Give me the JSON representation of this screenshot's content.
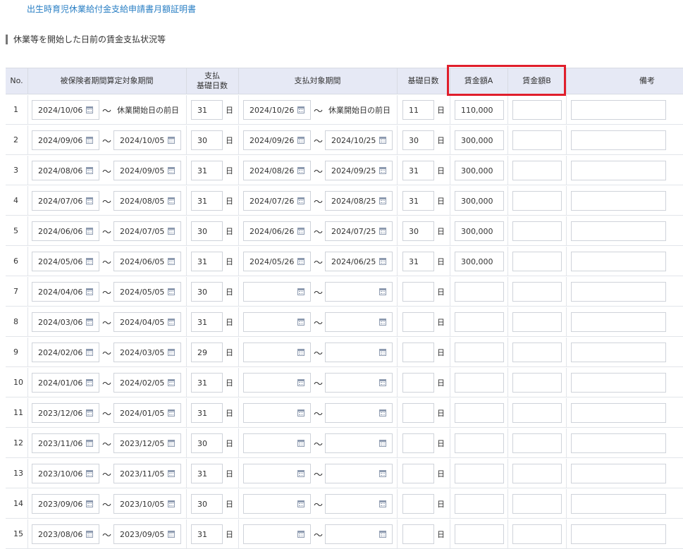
{
  "header": {
    "link_text": "出生時育児休業給付金支給申請書月額証明書"
  },
  "section": {
    "title": "休業等を開始した日前の賃金支払状況等"
  },
  "columns": {
    "no": "No.",
    "period": "被保険者期間算定対象期間",
    "base_days_l1": "支払",
    "base_days_l2": "基礎日数",
    "pay_period": "支払対象期間",
    "days": "基礎日数",
    "wage_a": "賃金額A",
    "wage_b": "賃金額B",
    "notes": "備考"
  },
  "labels": {
    "tilde": "〜",
    "day_unit": "日"
  },
  "icons": {
    "calendar": "calendar-icon"
  },
  "colors": {
    "accent_link": "#2a7fc4",
    "header_bg": "#e6e9f5",
    "highlight": "#e01e2b"
  },
  "rows": [
    {
      "no": "1",
      "p_from": "2024/10/06",
      "p_to": "休業開始日の前日",
      "p_to_plain": true,
      "base": "31",
      "pay_from": "2024/10/26",
      "pay_to": "休業開始日の前日",
      "pay_to_plain": true,
      "days": "11",
      "wage_a": "110,000",
      "wage_b": "",
      "notes": ""
    },
    {
      "no": "2",
      "p_from": "2024/09/06",
      "p_to": "2024/10/05",
      "base": "30",
      "pay_from": "2024/09/26",
      "pay_to": "2024/10/25",
      "days": "30",
      "wage_a": "300,000",
      "wage_b": "",
      "notes": ""
    },
    {
      "no": "3",
      "p_from": "2024/08/06",
      "p_to": "2024/09/05",
      "base": "31",
      "pay_from": "2024/08/26",
      "pay_to": "2024/09/25",
      "days": "31",
      "wage_a": "300,000",
      "wage_b": "",
      "notes": ""
    },
    {
      "no": "4",
      "p_from": "2024/07/06",
      "p_to": "2024/08/05",
      "base": "31",
      "pay_from": "2024/07/26",
      "pay_to": "2024/08/25",
      "days": "31",
      "wage_a": "300,000",
      "wage_b": "",
      "notes": ""
    },
    {
      "no": "5",
      "p_from": "2024/06/06",
      "p_to": "2024/07/05",
      "base": "30",
      "pay_from": "2024/06/26",
      "pay_to": "2024/07/25",
      "days": "30",
      "wage_a": "300,000",
      "wage_b": "",
      "notes": ""
    },
    {
      "no": "6",
      "p_from": "2024/05/06",
      "p_to": "2024/06/05",
      "base": "31",
      "pay_from": "2024/05/26",
      "pay_to": "2024/06/25",
      "days": "31",
      "wage_a": "300,000",
      "wage_b": "",
      "notes": ""
    },
    {
      "no": "7",
      "p_from": "2024/04/06",
      "p_to": "2024/05/05",
      "base": "30",
      "pay_from": "",
      "pay_to": "",
      "days": "",
      "wage_a": "",
      "wage_b": "",
      "notes": ""
    },
    {
      "no": "8",
      "p_from": "2024/03/06",
      "p_to": "2024/04/05",
      "base": "31",
      "pay_from": "",
      "pay_to": "",
      "days": "",
      "wage_a": "",
      "wage_b": "",
      "notes": ""
    },
    {
      "no": "9",
      "p_from": "2024/02/06",
      "p_to": "2024/03/05",
      "base": "29",
      "pay_from": "",
      "pay_to": "",
      "days": "",
      "wage_a": "",
      "wage_b": "",
      "notes": ""
    },
    {
      "no": "10",
      "p_from": "2024/01/06",
      "p_to": "2024/02/05",
      "base": "31",
      "pay_from": "",
      "pay_to": "",
      "days": "",
      "wage_a": "",
      "wage_b": "",
      "notes": ""
    },
    {
      "no": "11",
      "p_from": "2023/12/06",
      "p_to": "2024/01/05",
      "base": "31",
      "pay_from": "",
      "pay_to": "",
      "days": "",
      "wage_a": "",
      "wage_b": "",
      "notes": ""
    },
    {
      "no": "12",
      "p_from": "2023/11/06",
      "p_to": "2023/12/05",
      "base": "30",
      "pay_from": "",
      "pay_to": "",
      "days": "",
      "wage_a": "",
      "wage_b": "",
      "notes": ""
    },
    {
      "no": "13",
      "p_from": "2023/10/06",
      "p_to": "2023/11/05",
      "base": "31",
      "pay_from": "",
      "pay_to": "",
      "days": "",
      "wage_a": "",
      "wage_b": "",
      "notes": ""
    },
    {
      "no": "14",
      "p_from": "2023/09/06",
      "p_to": "2023/10/05",
      "base": "30",
      "pay_from": "",
      "pay_to": "",
      "days": "",
      "wage_a": "",
      "wage_b": "",
      "notes": ""
    },
    {
      "no": "15",
      "p_from": "2023/08/06",
      "p_to": "2023/09/05",
      "base": "31",
      "pay_from": "",
      "pay_to": "",
      "days": "",
      "wage_a": "",
      "wage_b": "",
      "notes": ""
    }
  ]
}
